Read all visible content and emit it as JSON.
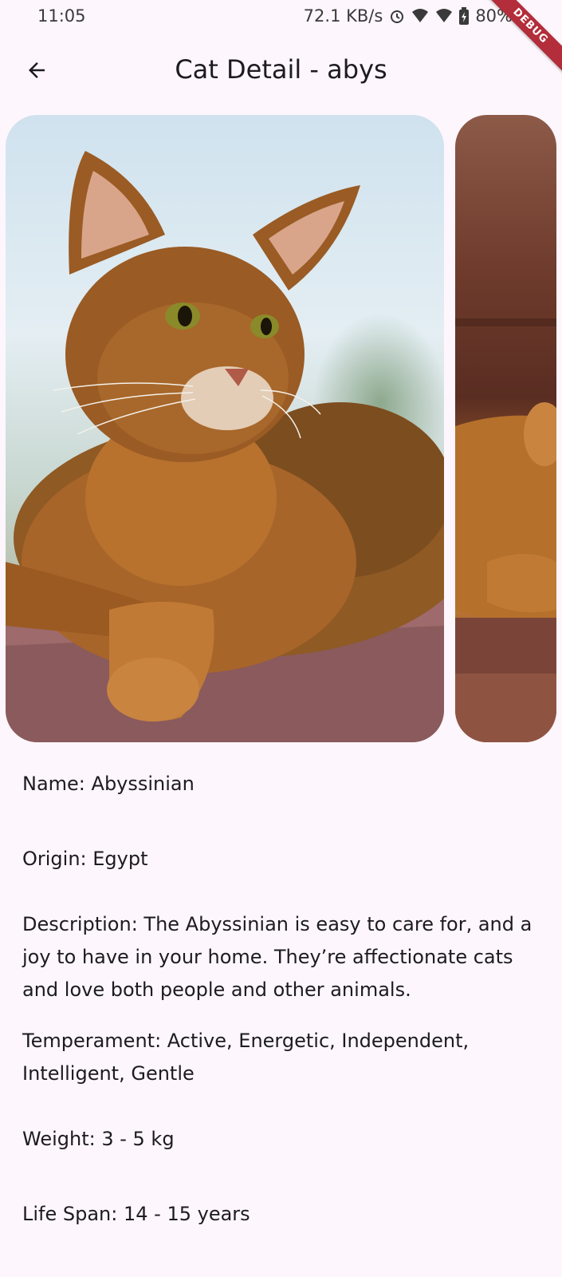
{
  "status_bar": {
    "time": "11:05",
    "network_speed": "72.1 KB/s",
    "battery": "80%",
    "icons": [
      "alarm-icon",
      "wifi-icon",
      "signal-icon",
      "battery-icon"
    ]
  },
  "debug_banner": "DEBUG",
  "app_bar": {
    "title": "Cat Detail - abys",
    "back_icon": "arrow-back-icon"
  },
  "carousel": {
    "images": [
      {
        "subject": "Abyssinian cat lying on a brick ledge"
      },
      {
        "subject": "Abyssinian cat on a brown couch"
      }
    ]
  },
  "details": {
    "name": "Name: Abyssinian",
    "origin": "Origin: Egypt",
    "description": "Description: The Abyssinian is easy to care for, and a joy to have in your home. They’re affectionate cats and love both people and other animals.",
    "temperament": "Temperament: Active, Energetic, Independent, Intelligent, Gentle",
    "weight": "Weight: 3 - 5 kg",
    "life_span": "Life Span: 14 - 15 years"
  },
  "colors": {
    "background": "#fdf6fd",
    "text": "#1d1b20",
    "debug_ribbon": "#b32d3a"
  }
}
